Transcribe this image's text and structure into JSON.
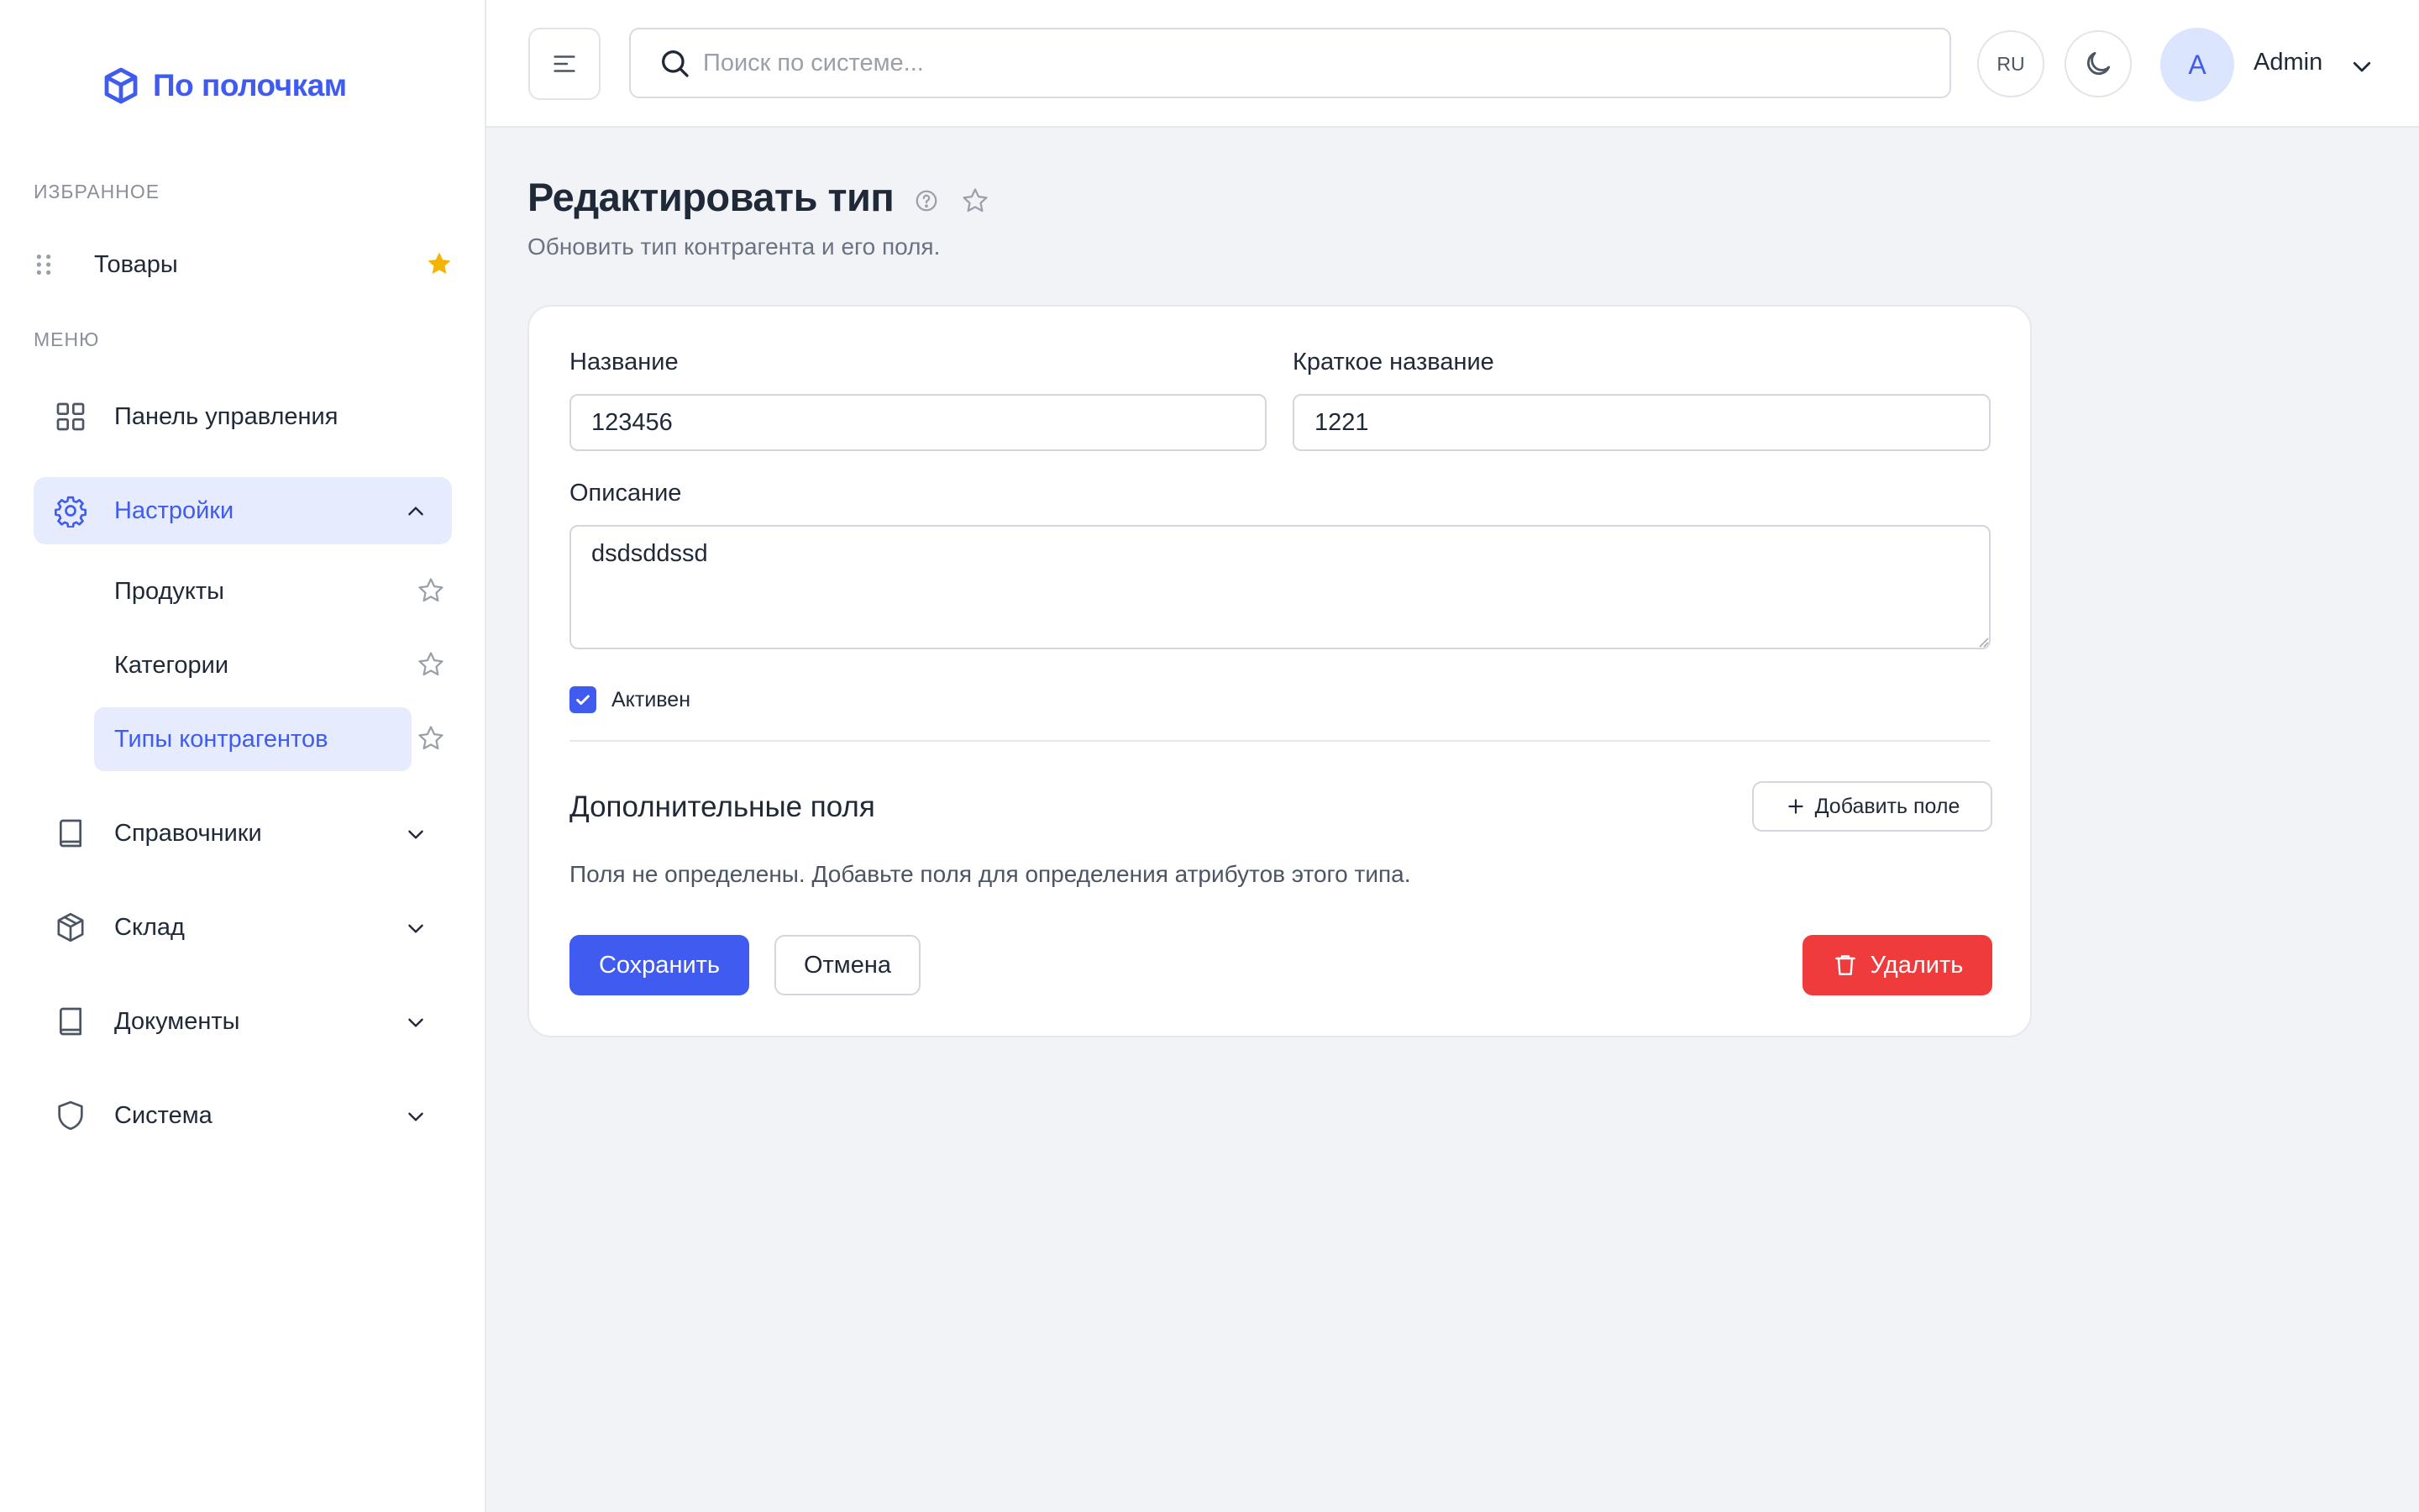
{
  "brand": {
    "name": "По полочкам"
  },
  "sidebar": {
    "favorites_label": "ИЗБРАННОЕ",
    "favorites": [
      {
        "label": "Товары",
        "icon": "star-filled-icon",
        "starred": true
      }
    ],
    "menu_label": "МЕНЮ",
    "items": [
      {
        "label": "Панель управления",
        "icon": "grid-icon"
      },
      {
        "label": "Настройки",
        "icon": "gear-icon",
        "expanded": true,
        "active": true,
        "children": [
          {
            "label": "Продукты"
          },
          {
            "label": "Категории"
          },
          {
            "label": "Типы контрагентов",
            "active": true
          }
        ]
      },
      {
        "label": "Справочники",
        "icon": "book-icon"
      },
      {
        "label": "Склад",
        "icon": "box-icon"
      },
      {
        "label": "Документы",
        "icon": "book-icon"
      },
      {
        "label": "Система",
        "icon": "shield-icon"
      }
    ]
  },
  "header": {
    "search_placeholder": "Поиск по системе...",
    "lang": "RU",
    "avatar_initial": "A",
    "user_name": "Admin"
  },
  "page": {
    "title": "Редактировать тип",
    "subtitle": "Обновить тип контрагента и его поля."
  },
  "form": {
    "name_label": "Название",
    "name_value": "123456",
    "short_name_label": "Краткое название",
    "short_name_value": "1221",
    "description_label": "Описание",
    "description_value": "dsdsddssd",
    "active_label": "Активен",
    "active_checked": true,
    "extra_fields_title": "Дополнительные поля",
    "add_field_label": "Добавить поле",
    "empty_message": "Поля не определены. Добавьте поля для определения атрибутов этого типа.",
    "save_label": "Сохранить",
    "cancel_label": "Отмена",
    "delete_label": "Удалить"
  },
  "colors": {
    "accent": "#3f5bf0",
    "active_bg": "#e6ecfd",
    "danger": "#ef3b3b",
    "star": "#f4b400"
  }
}
